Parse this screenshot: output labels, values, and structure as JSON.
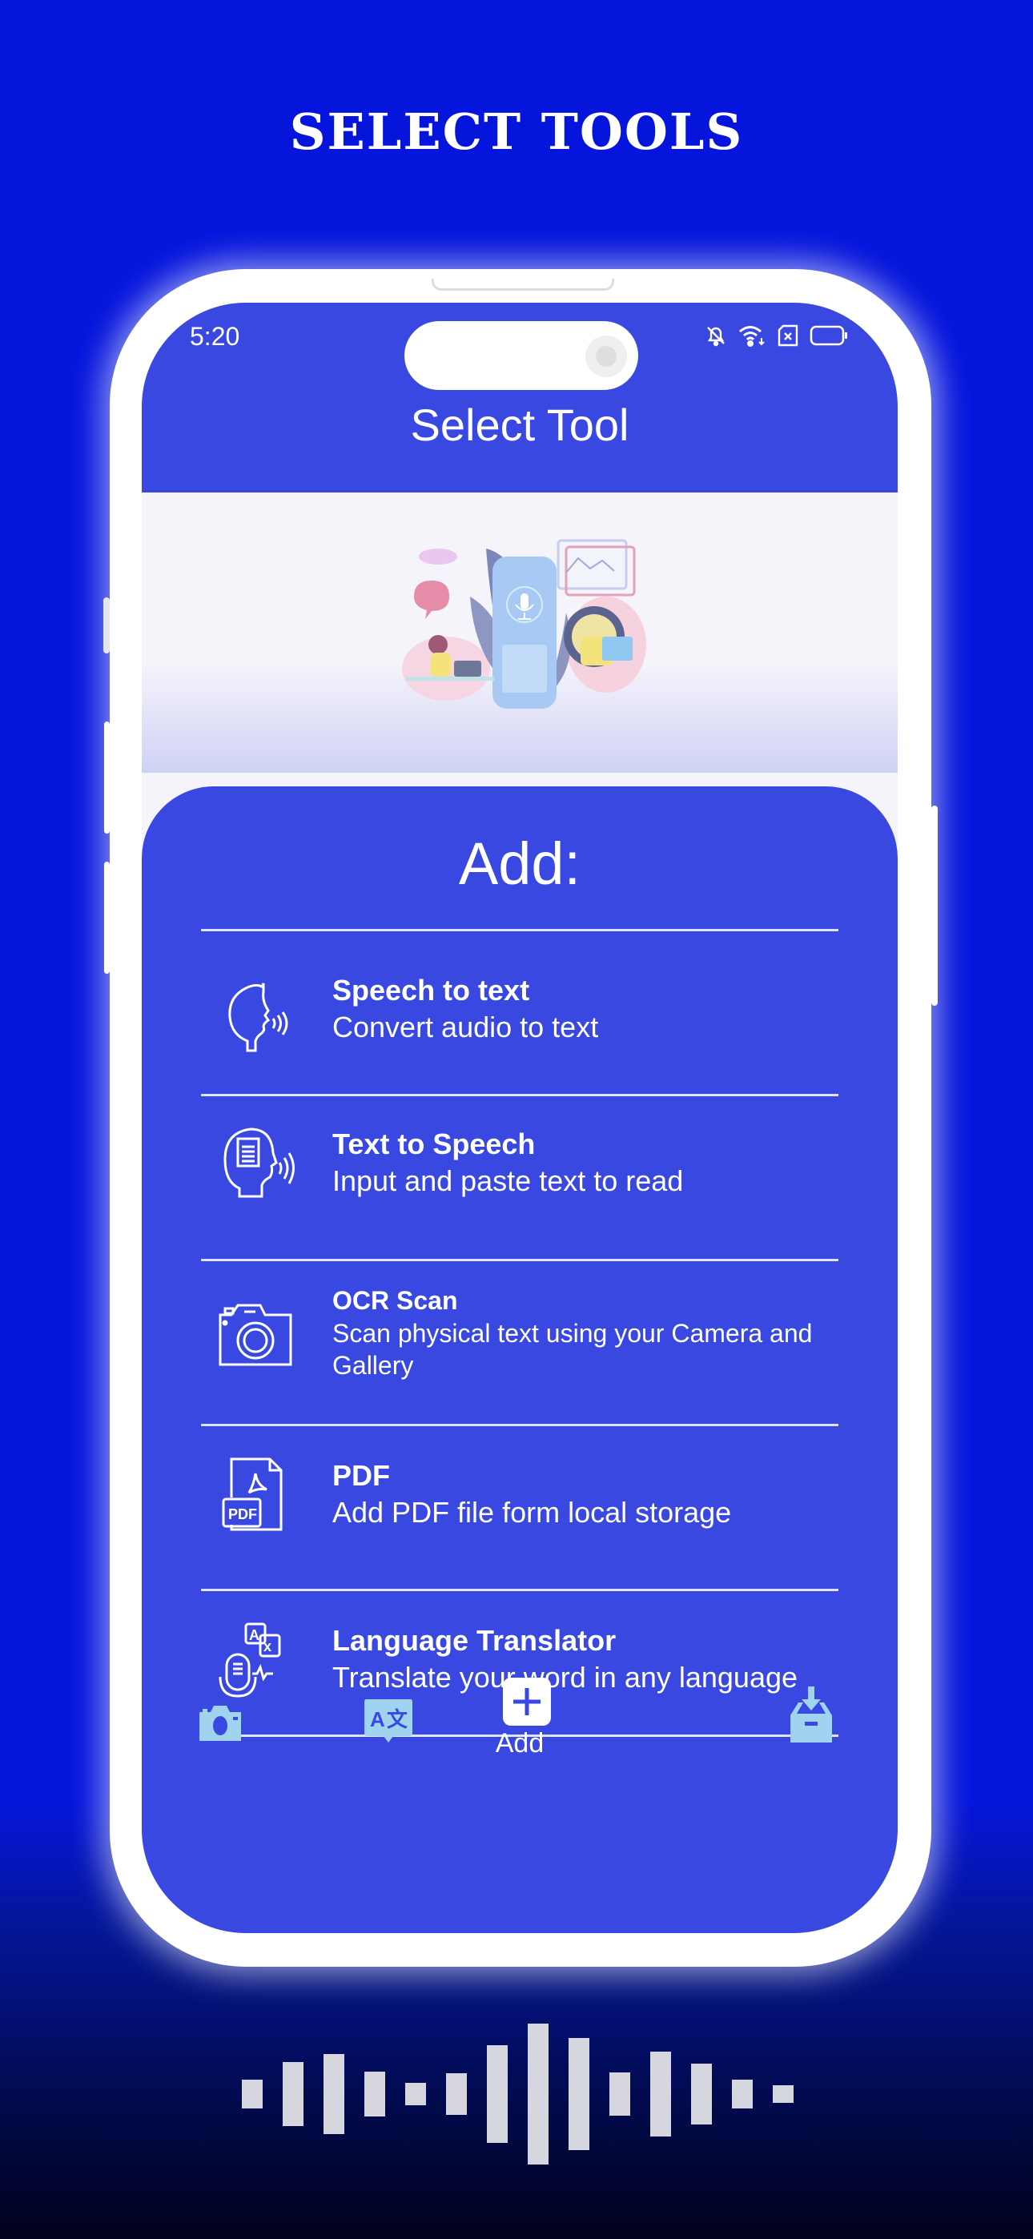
{
  "promo": {
    "title": "SELECT TOOLS"
  },
  "status_bar": {
    "time": "5:20",
    "icons": [
      "bell-off-icon",
      "wifi-icon",
      "sim-missing-icon",
      "battery-icon"
    ]
  },
  "app_bar": {
    "title": "Select Tool"
  },
  "hero": {
    "illustration": "voice-assistant-illustration"
  },
  "sheet": {
    "title": "Add:",
    "tools": [
      {
        "name": "Speech to text",
        "description": "Convert audio to text",
        "icon": "speaking-head-icon"
      },
      {
        "name": "Text to Speech",
        "description": "Input and paste text to read",
        "icon": "head-document-icon"
      },
      {
        "name": "OCR Scan",
        "description": "Scan physical text using your Camera and Gallery",
        "icon": "camera-icon"
      },
      {
        "name": "PDF",
        "description": "Add PDF file form local storage",
        "icon": "pdf-file-icon"
      },
      {
        "name": "Language Translator",
        "description": "Translate your word in any language",
        "icon": "translator-mic-icon"
      }
    ]
  },
  "bottom_nav": {
    "items": [
      {
        "icon": "camera-icon",
        "label": ""
      },
      {
        "icon": "translate-icon",
        "label": ""
      },
      {
        "icon": "add-icon",
        "label": "Add",
        "active": true
      },
      {
        "icon": "inbox-download-icon",
        "label": ""
      }
    ]
  },
  "colors": {
    "background": "#0515dc",
    "primary": "#3848e0",
    "nav_icon": "#9fd3f0",
    "text": "#ffffff"
  },
  "waveform": {
    "levels": [
      0.2,
      0.45,
      0.57,
      0.32,
      0.16,
      0.29,
      0.69,
      1.0,
      0.79,
      0.31,
      0.6,
      0.43,
      0.21,
      0.13
    ]
  }
}
